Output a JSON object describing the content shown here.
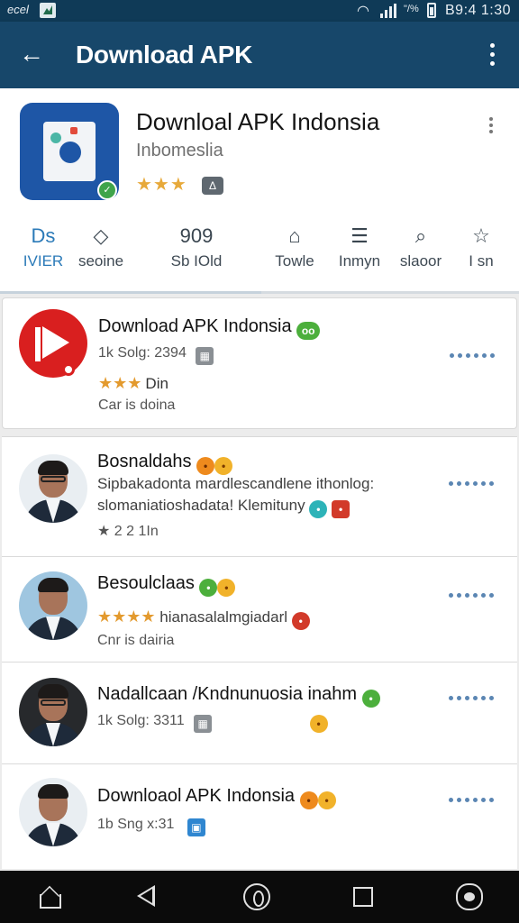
{
  "status_bar": {
    "carrier": "ecel",
    "percent": "\"/%",
    "time": "B9:4 1:30",
    "icons": [
      "notification-icon",
      "wifi-icon",
      "signal-icon",
      "battery-icon"
    ]
  },
  "app_bar": {
    "title": "Download APK",
    "back_icon": "arrow-left-icon",
    "menu_icon": "more-vert-icon"
  },
  "app_header": {
    "name": "Downloal APK Indonsia",
    "developer": "Inbomeslia",
    "stars": "★★★",
    "rated_badge": "Δ"
  },
  "stats": [
    {
      "glyph": "Ds",
      "label": "IVIER",
      "active": true
    },
    {
      "glyph": "◇",
      "label": "seoine"
    },
    {
      "glyph": "909",
      "label": "Sb IOld"
    },
    {
      "glyph": "⌂",
      "label": "Towle"
    },
    {
      "glyph": "☰",
      "label": "Inmyn"
    },
    {
      "glyph": "⌕",
      "label": "slaoor"
    },
    {
      "glyph": "☆",
      "label": "I sn"
    }
  ],
  "featured": {
    "title": "Download APK Indonsia",
    "title_badge": "oo",
    "meta": "1k Solg: 2394",
    "stars": "★★★",
    "stars_label": "Din",
    "category": "Car is doina"
  },
  "list": [
    {
      "title": "Bosnaldahs",
      "line1": "Sipbakadonta mardlescandlene ithonlog:",
      "line2": "slomaniatioshadata! Klemituny",
      "meta": "★ 2  2 1In"
    },
    {
      "title": "Besoulclaas",
      "stars": "★★★★",
      "line1": "hianasalalmgiadarl",
      "line2": "Cnr is dairia"
    },
    {
      "title": "Nadallcaan /Kndnunuosia inahm",
      "meta": "1k Solg: 3311"
    },
    {
      "title": "Downloaol APK Indonsia",
      "meta": "1b Sng x:31"
    }
  ],
  "nav_bar": {
    "icons": [
      "home-icon",
      "back-triangle-icon",
      "home-circle-icon",
      "recents-square-icon",
      "assistant-icon"
    ]
  },
  "colors": {
    "app_bar": "#17476a",
    "status_bar": "#0f3a57",
    "accent": "#2b7ab8",
    "star": "#e7a93a"
  }
}
